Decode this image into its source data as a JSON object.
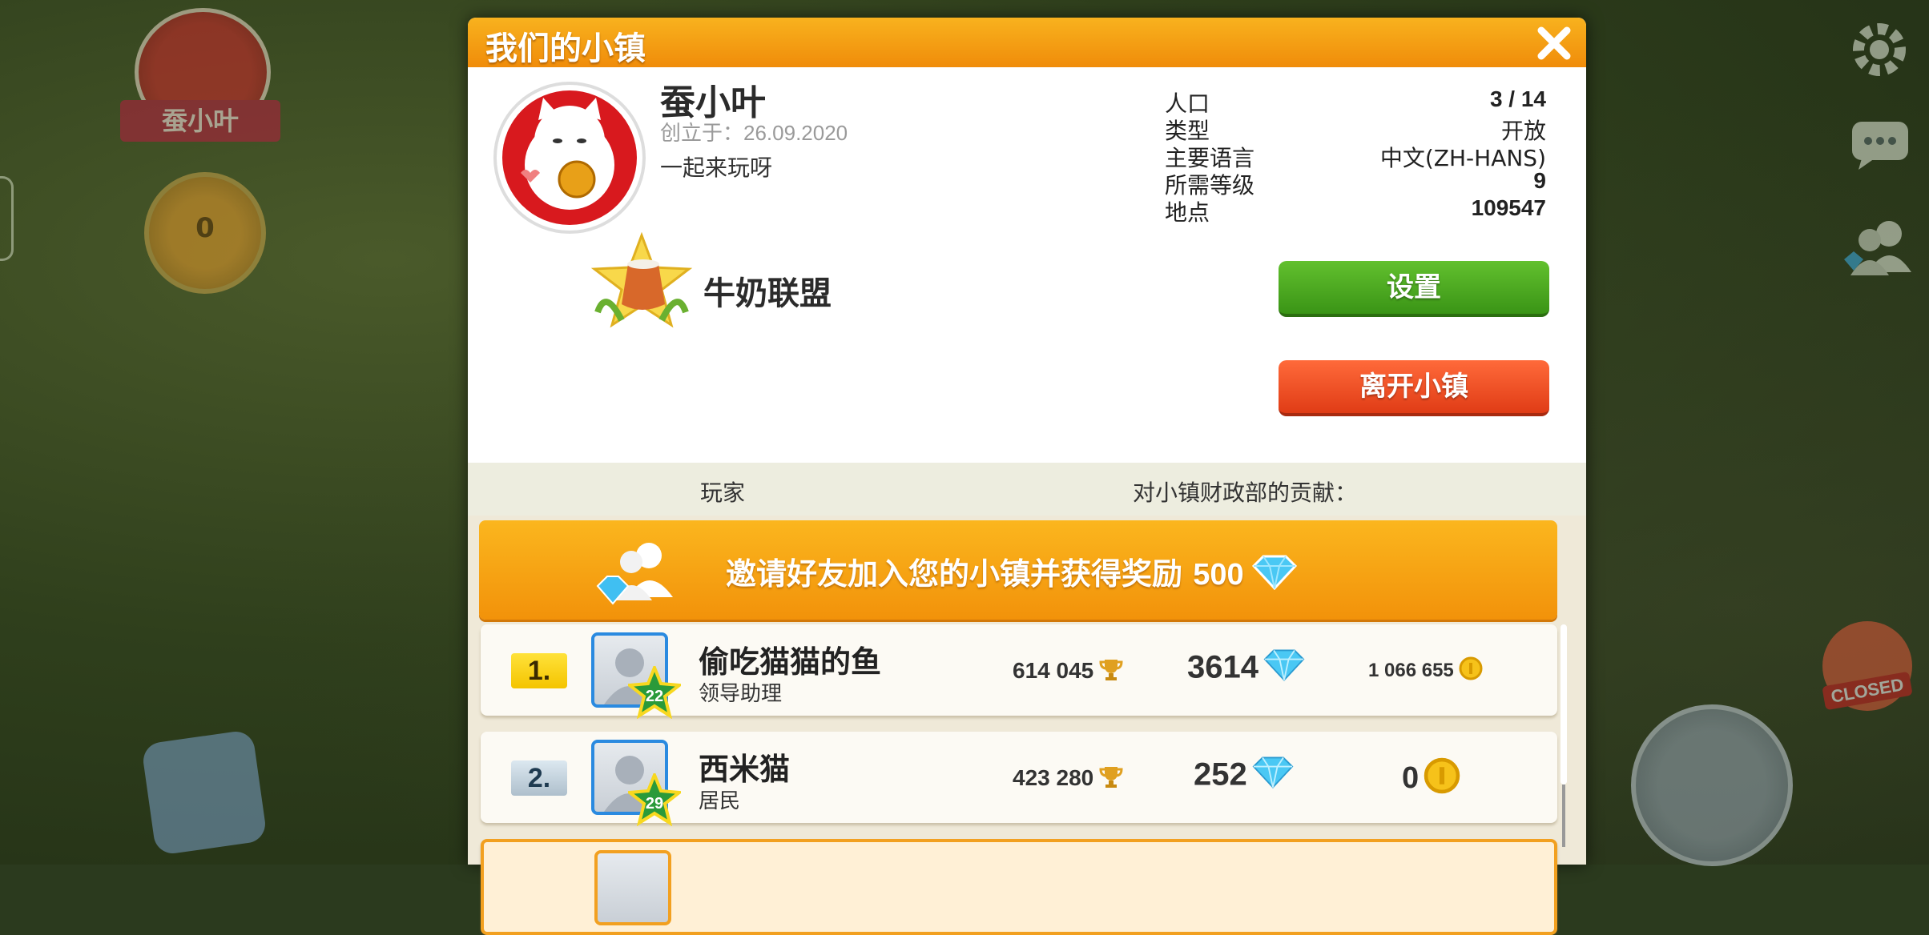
{
  "modal": {
    "title": "我们的小镇",
    "town": {
      "name": "蚕小叶",
      "founded_label": "创立于：",
      "founded_date": "26.09.2020",
      "motto": "一起来玩呀"
    },
    "info": [
      {
        "label": "人口",
        "value": "3 / 14"
      },
      {
        "label": "类型",
        "value": "开放"
      },
      {
        "label": "主要语言",
        "value": "中文(ZH-HANS)"
      },
      {
        "label": "所需等级",
        "value": "9"
      },
      {
        "label": "地点",
        "value": "109547"
      }
    ],
    "league": "牛奶联盟",
    "settings_label": "设置",
    "leave_label": "离开小镇",
    "columns": {
      "player": "玩家",
      "contribution": "对小镇财政部的贡献："
    },
    "invite": {
      "text": "邀请好友加入您的小镇并获得奖励",
      "amount": "500"
    },
    "players": [
      {
        "rank": "1.",
        "level": "22",
        "name": "偷吃猫猫的鱼",
        "role": "领导助理",
        "trophies": "614 045",
        "gems": "3614",
        "coins": "1 066 655"
      },
      {
        "rank": "2.",
        "level": "29",
        "name": "西米猫",
        "role": "居民",
        "trophies": "423 280",
        "gems": "252",
        "coins": "0"
      }
    ]
  },
  "hud": {
    "town_badge_name": "蚕小叶",
    "level_pin": "0"
  },
  "icons": [
    "close-icon",
    "gear-icon",
    "chat-icon",
    "friends-icon",
    "gem-icon",
    "trophy-icon",
    "coin-icon"
  ],
  "colors": {
    "header": "#f5a014",
    "settings_button": "#4caa20",
    "leave_button": "#f04e22",
    "invite_banner": "#f7a616"
  }
}
